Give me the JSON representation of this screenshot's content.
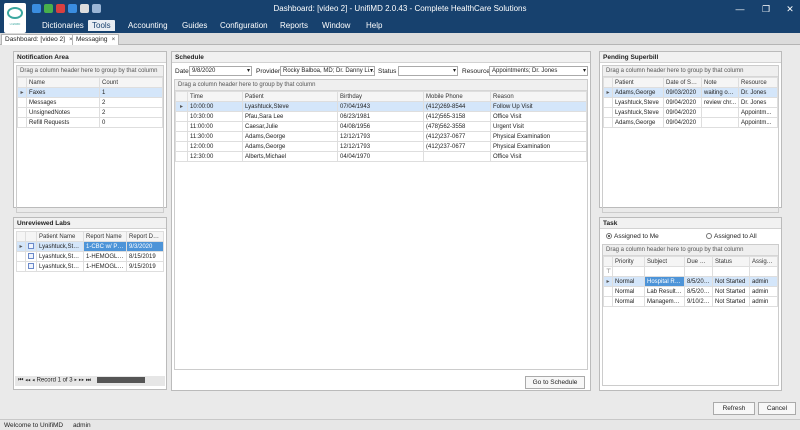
{
  "window": {
    "title": "Dashboard: [video 2] - UnifiMD 2.0.43 - Complete HealthCare Solutions",
    "logo_text": "UnifiMD"
  },
  "menu": [
    "Dictionaries",
    "Tools",
    "Accounting",
    "Guides",
    "Configuration",
    "Reports",
    "Window",
    "Help"
  ],
  "tabs": [
    {
      "label": "Dashboard: [video 2]"
    },
    {
      "label": "Messaging"
    }
  ],
  "notification": {
    "title": "Notification Area",
    "group_hint": "Drag a column header here to group by that column",
    "columns": [
      "Name",
      "Count"
    ],
    "rows": [
      [
        "Faxes",
        "1"
      ],
      [
        "Messages",
        "2"
      ],
      [
        "UnsignedNotes",
        "2"
      ],
      [
        "Refill Requests",
        "0"
      ]
    ]
  },
  "labs": {
    "title": "Unreviewed Labs",
    "columns": [
      "Patient Name",
      "Report Name",
      "Report Date"
    ],
    "rows": [
      [
        "Lyashtuck,Steve",
        "1-CBC w/ PDF",
        "9/3/2020"
      ],
      [
        "Lyashtuck,Steve",
        "1-HEMOGLOBI...",
        "8/15/2019"
      ],
      [
        "Lyashtuck,Steve",
        "1-HEMOGLOBI...",
        "9/15/2019"
      ]
    ],
    "nav_record": "Record 1 of 3"
  },
  "schedule": {
    "title": "Schedule",
    "date_label": "Date",
    "date_value": "9/8/2020",
    "provider_label": "Provider",
    "provider_value": "Rocky Balboa, MD; Dr. Danny Li...",
    "status_label": "Status",
    "status_value": "",
    "resource_label": "Resource",
    "resource_value": "Appointments; Dr. Jones",
    "group_hint": "Drag a column header here to group by that column",
    "columns": [
      "Time",
      "Patient",
      "Birthday",
      "Mobile Phone",
      "Reason"
    ],
    "rows": [
      [
        "10:00:00",
        "Lyashtuck,Steve",
        "07/04/1943",
        "(412)269-8544",
        "Follow Up Visit"
      ],
      [
        "10:30:00",
        "Pfau,Sara Lee",
        "06/23/1981",
        "(412)565-3158",
        "Office Visit"
      ],
      [
        "11:00:00",
        "Caesar,Julie",
        "04/08/1956",
        "(478)562-3558",
        "Urgent Visit"
      ],
      [
        "11:30:00",
        "Adams,George",
        "12/12/1793",
        "(412)237-0677",
        "Physical Examination"
      ],
      [
        "12:00:00",
        "Adams,George",
        "12/12/1793",
        "(412)237-0677",
        "Physical Examination"
      ],
      [
        "12:30:00",
        "Alberts,Michael",
        "04/04/1970",
        "",
        "Office Visit"
      ]
    ],
    "go_button": "Go to Schedule"
  },
  "superbill": {
    "title": "Pending Superbill",
    "group_hint": "Drag a column header here to group by that column",
    "columns": [
      "Patient",
      "Date of Se...",
      "Note",
      "Resource"
    ],
    "rows": [
      [
        "Adams,George",
        "09/03/2020",
        "waiting on ...",
        "Dr. Jones"
      ],
      [
        "Lyashtuck,Steve",
        "09/04/2020",
        "review chr...",
        "Dr. Jones"
      ],
      [
        "Lyashtuck,Steve",
        "09/04/2020",
        "",
        "Appointm..."
      ],
      [
        "Adams,George",
        "09/04/2020",
        "",
        "Appointm..."
      ]
    ]
  },
  "task": {
    "title": "Task",
    "assigned_me": "Assigned to Me",
    "assigned_all": "Assigned to All",
    "group_hint": "Drag a column header here to group by that column",
    "columns": [
      "Priority",
      "Subject",
      "Due Date",
      "Status",
      "Assigne..."
    ],
    "rows": [
      [
        "Normal",
        "Hospital Revi...",
        "8/5/2020",
        "Not Started",
        "admin"
      ],
      [
        "Normal",
        "Lab Results ...",
        "8/5/2020",
        "Not Started",
        "admin"
      ],
      [
        "Normal",
        "Management...",
        "9/10/20...",
        "Not Started",
        "admin"
      ]
    ]
  },
  "footer": {
    "refresh": "Refresh",
    "cancel": "Cancel"
  },
  "status": {
    "welcome": "Welcome to UnifiMD",
    "user": "admin"
  }
}
